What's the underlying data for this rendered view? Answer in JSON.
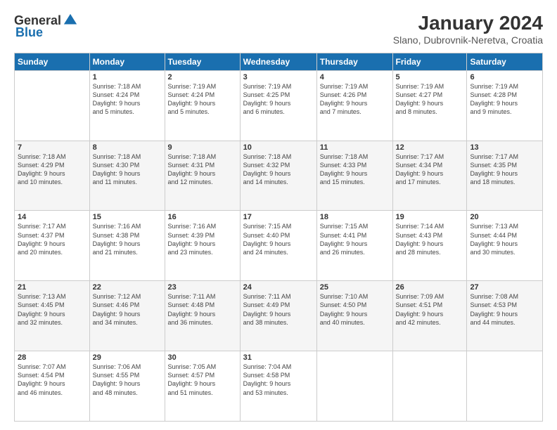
{
  "header": {
    "logo_general": "General",
    "logo_blue": "Blue",
    "month_title": "January 2024",
    "location": "Slano, Dubrovnik-Neretva, Croatia"
  },
  "weekdays": [
    "Sunday",
    "Monday",
    "Tuesday",
    "Wednesday",
    "Thursday",
    "Friday",
    "Saturday"
  ],
  "rows": [
    {
      "shaded": false,
      "cells": [
        {
          "day": "",
          "info": ""
        },
        {
          "day": "1",
          "info": "Sunrise: 7:18 AM\nSunset: 4:24 PM\nDaylight: 9 hours\nand 5 minutes."
        },
        {
          "day": "2",
          "info": "Sunrise: 7:19 AM\nSunset: 4:24 PM\nDaylight: 9 hours\nand 5 minutes."
        },
        {
          "day": "3",
          "info": "Sunrise: 7:19 AM\nSunset: 4:25 PM\nDaylight: 9 hours\nand 6 minutes."
        },
        {
          "day": "4",
          "info": "Sunrise: 7:19 AM\nSunset: 4:26 PM\nDaylight: 9 hours\nand 7 minutes."
        },
        {
          "day": "5",
          "info": "Sunrise: 7:19 AM\nSunset: 4:27 PM\nDaylight: 9 hours\nand 8 minutes."
        },
        {
          "day": "6",
          "info": "Sunrise: 7:19 AM\nSunset: 4:28 PM\nDaylight: 9 hours\nand 9 minutes."
        }
      ]
    },
    {
      "shaded": true,
      "cells": [
        {
          "day": "7",
          "info": "Sunrise: 7:18 AM\nSunset: 4:29 PM\nDaylight: 9 hours\nand 10 minutes."
        },
        {
          "day": "8",
          "info": "Sunrise: 7:18 AM\nSunset: 4:30 PM\nDaylight: 9 hours\nand 11 minutes."
        },
        {
          "day": "9",
          "info": "Sunrise: 7:18 AM\nSunset: 4:31 PM\nDaylight: 9 hours\nand 12 minutes."
        },
        {
          "day": "10",
          "info": "Sunrise: 7:18 AM\nSunset: 4:32 PM\nDaylight: 9 hours\nand 14 minutes."
        },
        {
          "day": "11",
          "info": "Sunrise: 7:18 AM\nSunset: 4:33 PM\nDaylight: 9 hours\nand 15 minutes."
        },
        {
          "day": "12",
          "info": "Sunrise: 7:17 AM\nSunset: 4:34 PM\nDaylight: 9 hours\nand 17 minutes."
        },
        {
          "day": "13",
          "info": "Sunrise: 7:17 AM\nSunset: 4:35 PM\nDaylight: 9 hours\nand 18 minutes."
        }
      ]
    },
    {
      "shaded": false,
      "cells": [
        {
          "day": "14",
          "info": "Sunrise: 7:17 AM\nSunset: 4:37 PM\nDaylight: 9 hours\nand 20 minutes."
        },
        {
          "day": "15",
          "info": "Sunrise: 7:16 AM\nSunset: 4:38 PM\nDaylight: 9 hours\nand 21 minutes."
        },
        {
          "day": "16",
          "info": "Sunrise: 7:16 AM\nSunset: 4:39 PM\nDaylight: 9 hours\nand 23 minutes."
        },
        {
          "day": "17",
          "info": "Sunrise: 7:15 AM\nSunset: 4:40 PM\nDaylight: 9 hours\nand 24 minutes."
        },
        {
          "day": "18",
          "info": "Sunrise: 7:15 AM\nSunset: 4:41 PM\nDaylight: 9 hours\nand 26 minutes."
        },
        {
          "day": "19",
          "info": "Sunrise: 7:14 AM\nSunset: 4:43 PM\nDaylight: 9 hours\nand 28 minutes."
        },
        {
          "day": "20",
          "info": "Sunrise: 7:13 AM\nSunset: 4:44 PM\nDaylight: 9 hours\nand 30 minutes."
        }
      ]
    },
    {
      "shaded": true,
      "cells": [
        {
          "day": "21",
          "info": "Sunrise: 7:13 AM\nSunset: 4:45 PM\nDaylight: 9 hours\nand 32 minutes."
        },
        {
          "day": "22",
          "info": "Sunrise: 7:12 AM\nSunset: 4:46 PM\nDaylight: 9 hours\nand 34 minutes."
        },
        {
          "day": "23",
          "info": "Sunrise: 7:11 AM\nSunset: 4:48 PM\nDaylight: 9 hours\nand 36 minutes."
        },
        {
          "day": "24",
          "info": "Sunrise: 7:11 AM\nSunset: 4:49 PM\nDaylight: 9 hours\nand 38 minutes."
        },
        {
          "day": "25",
          "info": "Sunrise: 7:10 AM\nSunset: 4:50 PM\nDaylight: 9 hours\nand 40 minutes."
        },
        {
          "day": "26",
          "info": "Sunrise: 7:09 AM\nSunset: 4:51 PM\nDaylight: 9 hours\nand 42 minutes."
        },
        {
          "day": "27",
          "info": "Sunrise: 7:08 AM\nSunset: 4:53 PM\nDaylight: 9 hours\nand 44 minutes."
        }
      ]
    },
    {
      "shaded": false,
      "cells": [
        {
          "day": "28",
          "info": "Sunrise: 7:07 AM\nSunset: 4:54 PM\nDaylight: 9 hours\nand 46 minutes."
        },
        {
          "day": "29",
          "info": "Sunrise: 7:06 AM\nSunset: 4:55 PM\nDaylight: 9 hours\nand 48 minutes."
        },
        {
          "day": "30",
          "info": "Sunrise: 7:05 AM\nSunset: 4:57 PM\nDaylight: 9 hours\nand 51 minutes."
        },
        {
          "day": "31",
          "info": "Sunrise: 7:04 AM\nSunset: 4:58 PM\nDaylight: 9 hours\nand 53 minutes."
        },
        {
          "day": "",
          "info": ""
        },
        {
          "day": "",
          "info": ""
        },
        {
          "day": "",
          "info": ""
        }
      ]
    }
  ]
}
